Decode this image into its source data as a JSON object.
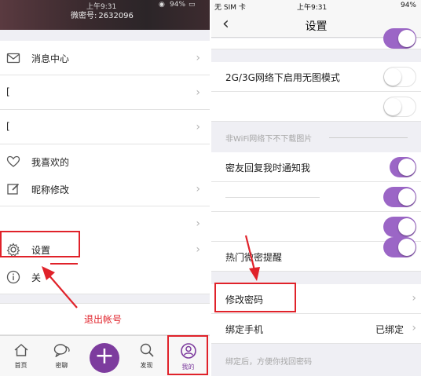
{
  "left": {
    "status": {
      "time": "上午9:31",
      "battery": "94%"
    },
    "header": {
      "wx_id_label": "微密号:",
      "wx_id_value": "2632096"
    },
    "menu": [
      {
        "label": "消息中心",
        "icon": "mail-icon"
      },
      {
        "label": "[",
        "icon": ""
      },
      {
        "label": "[",
        "icon": ""
      },
      {
        "label": "我喜欢的",
        "icon": "heart-icon"
      },
      {
        "label": "昵称修改",
        "icon": "edit-icon"
      },
      {
        "label": "",
        "icon": ""
      },
      {
        "label": "设置",
        "icon": "gear-icon"
      },
      {
        "label": "关",
        "icon": "info-icon"
      }
    ],
    "annotation": "退出帐号",
    "tabs": [
      {
        "label": "首页",
        "icon": "home-icon"
      },
      {
        "label": "密聊",
        "icon": "chat-icon"
      },
      {
        "label": "",
        "icon": "plus-icon"
      },
      {
        "label": "发现",
        "icon": "search-icon"
      },
      {
        "label": "我的",
        "icon": "profile-icon"
      }
    ],
    "plus_symbol": "+"
  },
  "right": {
    "status": {
      "carrier": "无 SIM 卡",
      "time": "上午9:31",
      "battery": "94%"
    },
    "nav": {
      "back": "‹",
      "title": "设置"
    },
    "rows": {
      "no_image_mode": "2G/3G网络下启用无图模式",
      "non_wifi_hint": "非WiFi网络下不下载图片",
      "reply_notify": "密友回复我时通知我",
      "hot_remind": "热门微密提醒",
      "change_password": "修改密码",
      "bind_phone": "绑定手机",
      "bind_status": "已绑定",
      "bind_hint": "绑定后，方便你找回密码"
    },
    "toggles": {
      "top_partial": true,
      "no_image_mode": false,
      "extra_1": false,
      "reply_notify": true,
      "extra_2": true,
      "extra_3": true,
      "hot_remind": true
    },
    "accent_color": "#9b66c6",
    "chevron": "›"
  },
  "colors": {
    "annotation_red": "#e0222a",
    "brand_purple": "#7d3c9e"
  }
}
